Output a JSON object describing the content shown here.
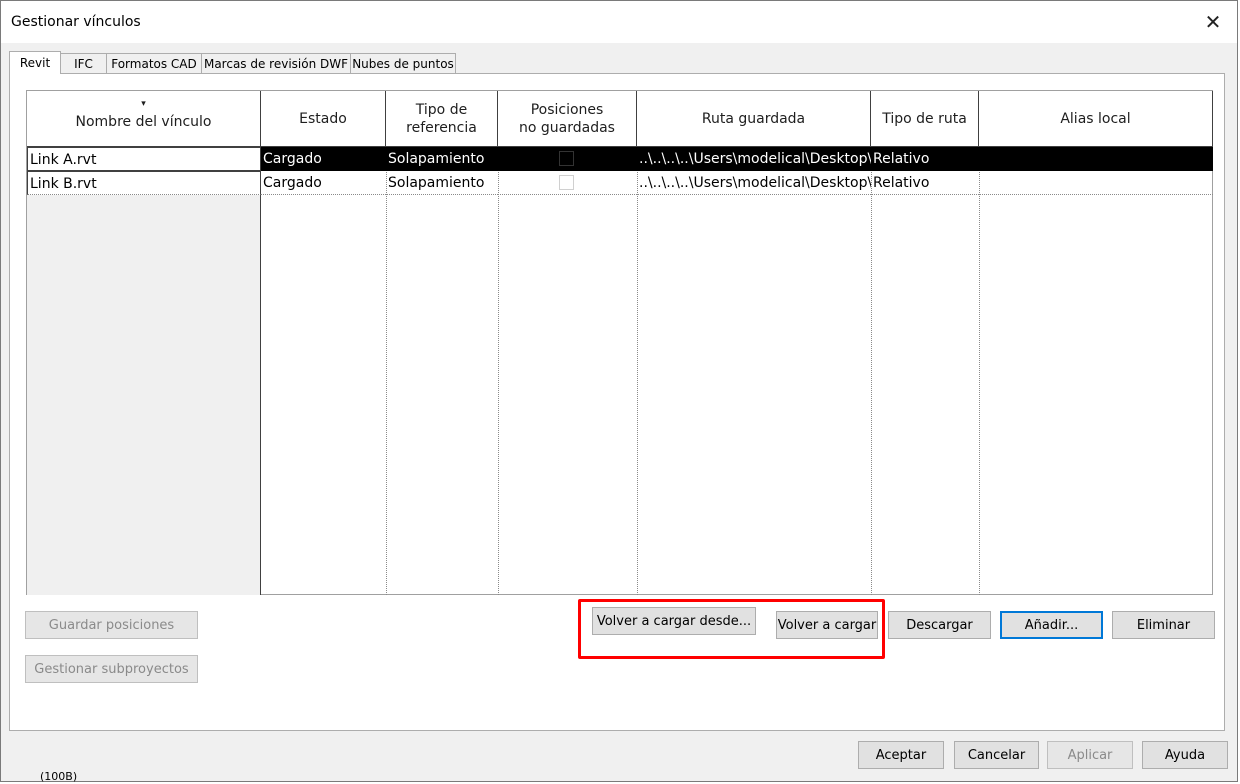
{
  "window": {
    "title": "Gestionar vínculos"
  },
  "tabs": [
    {
      "label": "Revit",
      "active": true
    },
    {
      "label": "IFC",
      "active": false
    },
    {
      "label": "Formatos CAD",
      "active": false
    },
    {
      "label": "Marcas de revisión DWF",
      "active": false
    },
    {
      "label": "Nubes de puntos",
      "active": false
    }
  ],
  "table": {
    "sort_indicator": "▾",
    "columns": [
      "Nombre del vínculo",
      "Estado",
      "Tipo de\nreferencia",
      "Posiciones\nno guardadas",
      "Ruta guardada",
      "Tipo de ruta",
      "Alias local"
    ],
    "rows": [
      {
        "name": "Link A.rvt",
        "estado": "Cargado",
        "tipo_referencia": "Solapamiento",
        "posiciones_no_guardadas": false,
        "ruta_guardada": "..\\..\\..\\..\\Users\\modelical\\Desktop\\L",
        "tipo_ruta": "Relativo",
        "alias_local": "",
        "selected": true
      },
      {
        "name": "Link B.rvt",
        "estado": "Cargado",
        "tipo_referencia": "Solapamiento",
        "posiciones_no_guardadas": false,
        "ruta_guardada": "..\\..\\..\\..\\Users\\modelical\\Desktop\\L",
        "tipo_ruta": "Relativo",
        "alias_local": "",
        "selected": false
      }
    ]
  },
  "buttons": {
    "guardar_posiciones": "Guardar posiciones",
    "gestionar_subproyectos": "Gestionar subproyectos",
    "volver_cargar_desde": "Volver a cargar desde...",
    "volver_cargar": "Volver a cargar",
    "descargar": "Descargar",
    "anadir": "Añadir...",
    "eliminar": "Eliminar",
    "aceptar": "Aceptar",
    "cancelar": "Cancelar",
    "aplicar": "Aplicar",
    "ayuda": "Ayuda"
  },
  "icons": {
    "close": "close-icon",
    "sort": "sort-down-icon"
  },
  "colors": {
    "highlight": "#ff0000",
    "selection": "#000000",
    "default_button_border": "#0078d7"
  },
  "background_fragment": "(100B)"
}
